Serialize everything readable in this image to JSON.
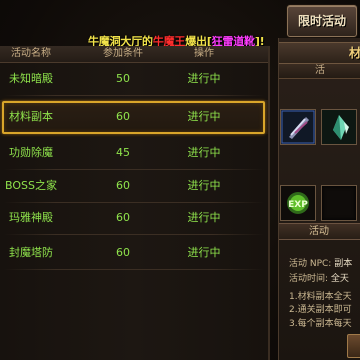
{
  "broadcast": {
    "part1": "牛魔洞大厅的",
    "part2": "牛魔王",
    "part3": "爆出[",
    "part4": "狂雷道靴",
    "part5": "]!"
  },
  "tab": {
    "label": "限时活动"
  },
  "list": {
    "headers": [
      "活动名称",
      "参加条件",
      "操作"
    ],
    "rows": [
      {
        "name": "未知暗殿",
        "level": "50",
        "status": "进行中"
      },
      {
        "name": "材料副本",
        "level": "60",
        "status": "进行中"
      },
      {
        "name": "功勋除魔",
        "level": "45",
        "status": "进行中"
      },
      {
        "name": "BOSS之家",
        "level": "60",
        "status": "进行中"
      },
      {
        "name": "玛雅神殿",
        "level": "60",
        "status": "进行中"
      },
      {
        "name": "封魔塔防",
        "level": "60",
        "status": "进行中"
      }
    ],
    "selected_index": 1
  },
  "detail": {
    "title": "材",
    "subtitle": "活",
    "rewards": [
      "feather-icon",
      "crystal-icon",
      "exp-orb-icon",
      "empty-slot"
    ],
    "exp_label": "EXP",
    "section_title": "活动",
    "npc_label": "活动 NPC:",
    "npc_value": "副本",
    "time_label": "活动时间:",
    "time_value": "全天",
    "rules": [
      "1.材料副本全天",
      "2.通关副本即可",
      "3.每个副本每天"
    ]
  },
  "colors": {
    "accent_green": "#8fe34c",
    "selected_border": "#d9a52a",
    "broadcast_yellow": "#f2e34a",
    "broadcast_red": "#ff2d2d",
    "broadcast_purple": "#ff3cff"
  }
}
